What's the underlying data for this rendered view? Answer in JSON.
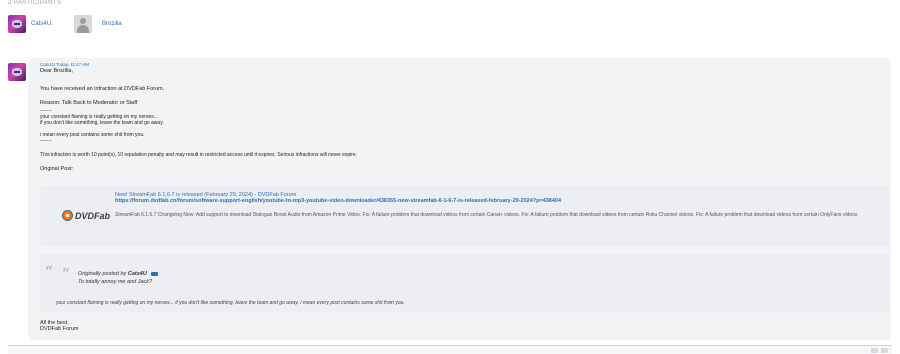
{
  "participants": {
    "header": "2 PARTICIPANTS",
    "items": [
      {
        "name": "Cats4U."
      },
      {
        "name": "Brozilla"
      }
    ]
  },
  "message": {
    "meta": "Cats4U Today, 11:47 AM",
    "greeting": "Dear Brozilla,",
    "line_infraction": "You have received an infraction at DVDFab Forum.",
    "line_reason": "Reason: Talk Back to Moderator or Staff",
    "separator": "-------",
    "body_1": "your constant flaming is really getting on my nerves...",
    "body_2": "if you don't like something, leave the team and go away.",
    "body_3": "i mean every post contains some shit from you.",
    "separator2": "-------",
    "worth": "This infraction is worth 10 point(s), 10 reputation penalty and may result in restricted access until it expires. Serious infractions will never expire.",
    "original_post": "Original Post:",
    "preview": {
      "title": "New! StreamFab 6.1.6.7 is released (February 29, 2024) - DVDFab Forum",
      "url": "https://forum.dvdfab.cn/forum/software-support-english/youtube-to-mp3-youtube-video-downloader/438355-new-streamfab-6-1-6-7-is-released-february-29-2024?p=438404",
      "description": "StreamFab 6.1.6.7 Changelog New: Add support to download Dialogue Boost Audio from Amazon Prime Video. Fix: A failure problem that download videos from certain Canal+ videos. Fix: A failure problem that download videos from certain Roku Channel videos. Fix: A failure problem that download videos from certain OnlyFans videos",
      "logo_text": "DVDFab"
    },
    "quote": {
      "prefix": "Originally posted by",
      "author": "Cats4U",
      "sub": "To totally annoy me and Jack?",
      "body": "your constant flaming is really getting on my nerves... if you don't like something, leave the team and go away. i mean every post contains some shit from you."
    },
    "signoff_1": "All the best,",
    "signoff_2": "DVDFab Forum"
  },
  "icons": {
    "quote": "quote-mark-icon",
    "link": "link-icon"
  },
  "colors": {
    "link": "#2f6fb5",
    "panel": "#f2f3f5"
  }
}
